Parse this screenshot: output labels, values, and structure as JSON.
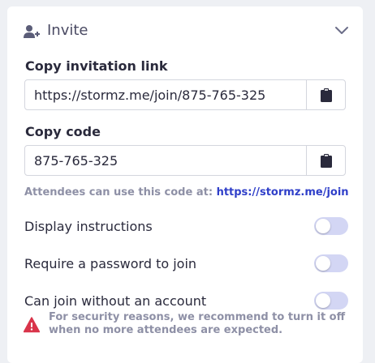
{
  "section": {
    "title": "Invite",
    "icon": "person-add-icon",
    "collapse_icon": "chevron-down-icon"
  },
  "invitation_link": {
    "label": "Copy invitation link",
    "value": "https://stormz.me/join/875-765-325",
    "copy_icon": "clipboard-icon"
  },
  "code": {
    "label": "Copy code",
    "value": "875-765-325",
    "copy_icon": "clipboard-icon"
  },
  "hint": {
    "text": "Attendees can use this code at:",
    "link": "https://stormz.me/join"
  },
  "settings": [
    {
      "label": "Display instructions",
      "enabled": false
    },
    {
      "label": "Require a password to join",
      "enabled": false
    },
    {
      "label": "Can join without an account",
      "enabled": false
    }
  ],
  "warning": {
    "icon": "warning-icon",
    "text": "For security reasons, we recommend to turn it off when no more attendees are expected."
  },
  "colors": {
    "accent": "#2f3fc9",
    "toggle_off": "#d3d6f4",
    "warning": "#d9344a",
    "muted_text": "#8e90a6"
  }
}
